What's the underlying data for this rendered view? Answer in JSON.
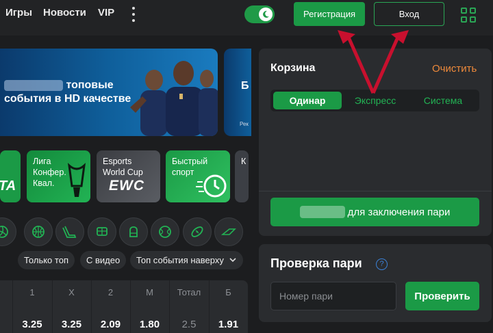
{
  "header": {
    "nav": [
      "Игры",
      "Новости",
      "VIP"
    ],
    "register_label": "Регистрация",
    "login_label": "Вход",
    "theme_toggle": "moon-icon",
    "colors": {
      "accent": "#1b9a46",
      "bg": "#1c1d1f",
      "panel": "#2a2c2f"
    }
  },
  "banner": {
    "line1": "топовые",
    "line2": "события в HD качестве",
    "next_letter": "Б",
    "next_small": "Рек"
  },
  "promos": [
    {
      "label": "TA"
    },
    {
      "label": "Лига\nКонфер.\nКвал."
    },
    {
      "label": "Esports\nWorld Cup",
      "logo": "EWC"
    },
    {
      "label": "Быстрый\nспорт"
    },
    {
      "label": "К"
    }
  ],
  "sport_icons": [
    "volleyball-icon",
    "basketball-icon",
    "hockey-icon",
    "table-tennis-icon",
    "boxing-icon",
    "tennis-icon",
    "american-football-icon",
    "formula-icon"
  ],
  "filters": {
    "only_top": "Только топ",
    "with_video": "С видео",
    "top_first": "Топ события наверху"
  },
  "table": {
    "headers": [
      "1",
      "X",
      "2",
      "М",
      "Тотал",
      "Б"
    ],
    "values": [
      "3.25",
      "3.25",
      "2.09",
      "1.80",
      "2.5",
      "1.91"
    ]
  },
  "cart": {
    "title": "Корзина",
    "clear_label": "Очистить",
    "tabs": [
      "Одинар",
      "Экспресс",
      "Система"
    ],
    "action_label": "для заключения пари"
  },
  "check": {
    "title": "Проверка пари",
    "help": "?",
    "placeholder": "Номер пари",
    "button": "Проверить"
  }
}
